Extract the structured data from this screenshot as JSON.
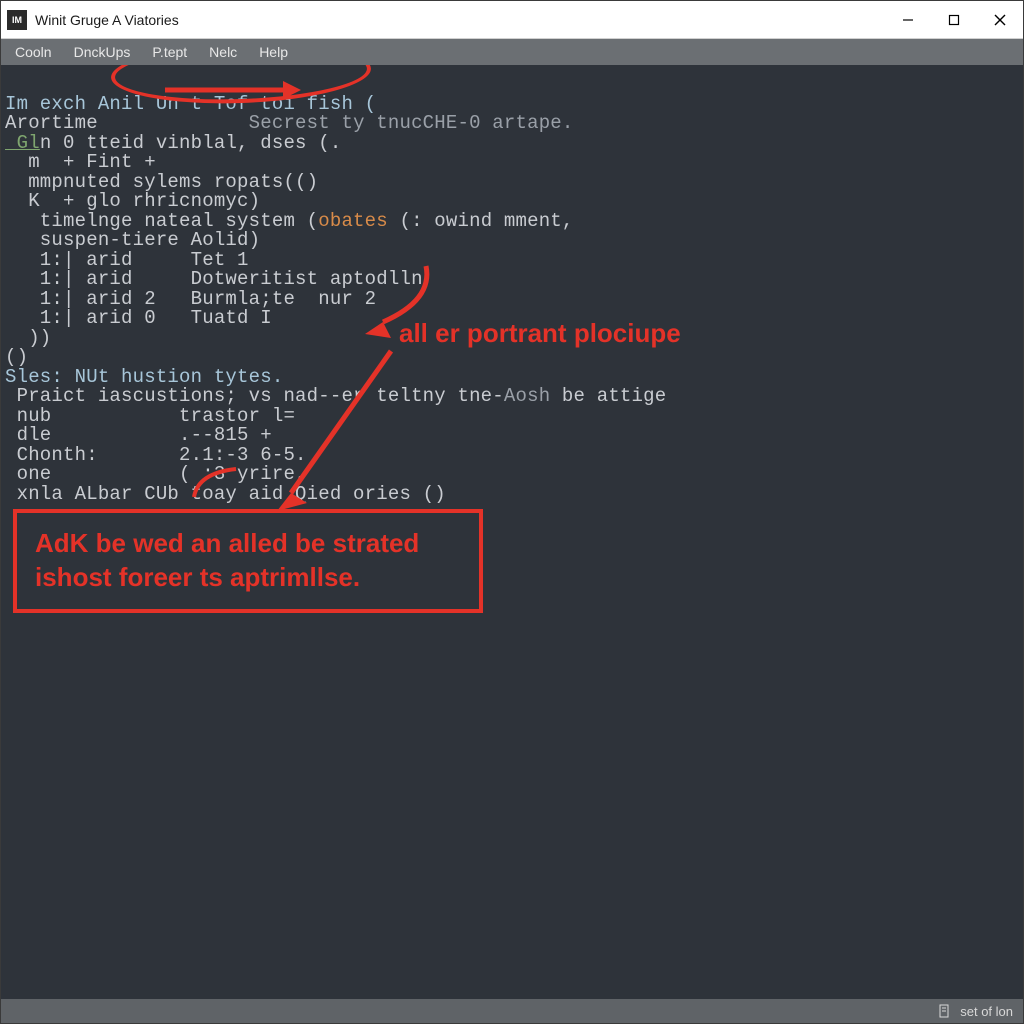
{
  "window": {
    "title": "Winit Gruge A Viatories",
    "app_icon_text": "IM"
  },
  "menu": {
    "items": [
      "Cooln",
      "DnckUps",
      "P.tept",
      "Nelc",
      "Help"
    ]
  },
  "code": {
    "l0": "Im exch Anil Un t Tof toi fish (",
    "l1a": "Arortime",
    "l1b": "             Secrest ty tnucCHE-0 artape.",
    "l2a": " Gl",
    "l2b": "n 0 tteid vinblal, dses (.",
    "l3": "  m  + Fint +",
    "l4": "  mmpnuted sylems ropats(()",
    "l5": "  K  + glo rhricnomyc)",
    "l6a": "   timelnge nateal system (",
    "l6b": "obates",
    "l6c": " (: owind mment,",
    "l7": "   suspen-tiere Aolid)",
    "l8": "   1:| arid     Tet 1",
    "l9": "   1:| arid     Dotweritist aptodlln",
    "l10": "   1:| arid 2   Burmla;te  nur 2",
    "l11": "   1:| arid 0   Tuatd I",
    "l12": "  ))",
    "l13": "()",
    "l14a": "Sles: NUt hustion tytes",
    "l14b": ".",
    "l15a": " Praict iascustions; vs nad--er teltny tne-",
    "l15b": "Aosh",
    "l15c": " be attige",
    "l16": " nub           trastor l=",
    "l17": " dle           .--815 +",
    "l18": " Chonth:       2.1:-3 6-5.",
    "l19": " one           ( :3 yrire,",
    "l20": " xnla ALbar CUb toay aid Qied ories ()"
  },
  "annotations": {
    "label1": "all er portrant plociupe",
    "box_line1": "AdK be wed an alled be strated",
    "box_line2": "ishost foreer ts aptrimllse."
  },
  "status": {
    "text": "set of lon"
  },
  "colors": {
    "annotation_red": "#e43228",
    "editor_bg": "#2e333a",
    "menubar_bg": "#6b6f73"
  }
}
